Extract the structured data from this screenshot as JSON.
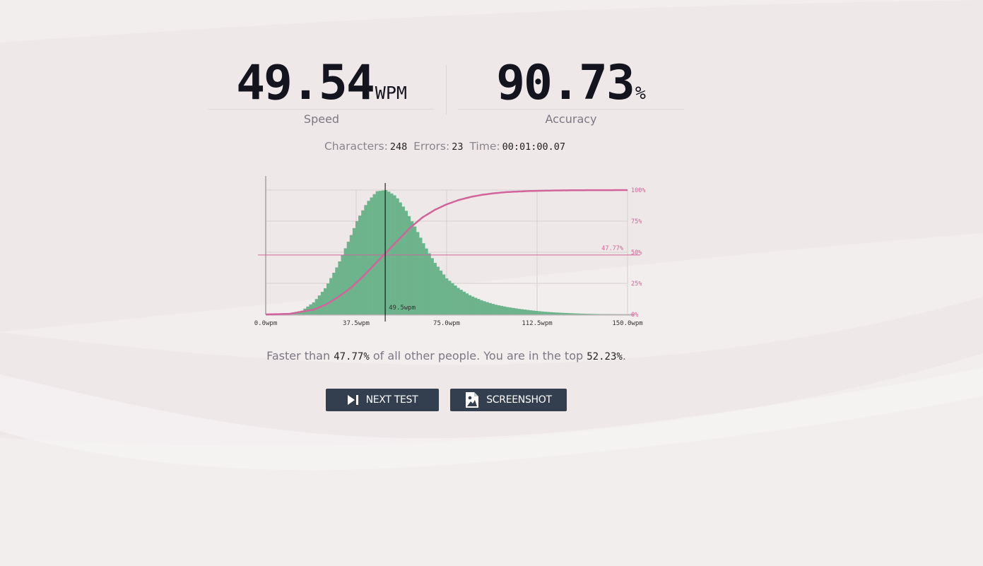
{
  "speed": {
    "value": "49.54",
    "unit": "WPM",
    "label": "Speed"
  },
  "accuracy": {
    "value": "90.73",
    "unit": "%",
    "label": "Accuracy"
  },
  "details": {
    "characters_label": "Characters:",
    "characters_value": "248",
    "errors_label": "Errors:",
    "errors_value": "23",
    "time_label": "Time:",
    "time_value": "00:01:00.07"
  },
  "summary": {
    "prefix": "Faster than",
    "faster_than": "47.77%",
    "middle": "of all other people. You are in the top",
    "top": "52.23%",
    "suffix": "."
  },
  "buttons": {
    "next_test": "NEXT TEST",
    "screenshot": "SCREENSHOT",
    "next_icon": "skip-next-icon",
    "screenshot_icon": "image-file-icon"
  },
  "colors": {
    "histogram": "#6db38c",
    "cumulative": "#d1649a",
    "button_bg": "#333f4e",
    "speed_marker": "#000000"
  },
  "chart_data": {
    "type": "area",
    "x_ticks": [
      "0.0wpm",
      "37.5wpm",
      "75.0wpm",
      "112.5wpm",
      "150.0wpm"
    ],
    "y_ticks_right": [
      "0%",
      "25%",
      "50%",
      "75%",
      "100%"
    ],
    "xlim": [
      0,
      150
    ],
    "ylim": [
      0,
      100
    ],
    "user_speed": 49.54,
    "user_speed_label": "49.5wpm",
    "percentile": 47.77,
    "percentile_label": "47.77%",
    "grid": true,
    "series": [
      {
        "kind": "histogram",
        "x": [
          0,
          10,
          15,
          20,
          25,
          30,
          35,
          38,
          42,
          46,
          50,
          54,
          58,
          62,
          66,
          70,
          75,
          80,
          85,
          90,
          95,
          100,
          105,
          110,
          115,
          120,
          125,
          130,
          135,
          140,
          145,
          150
        ],
        "values": [
          0,
          1,
          3,
          10,
          22,
          40,
          62,
          76,
          90,
          99,
          100,
          95,
          84,
          70,
          55,
          42,
          29,
          21,
          15,
          11,
          8,
          6,
          4.5,
          3.3,
          2.3,
          1.6,
          1.1,
          0.7,
          0.4,
          0.2,
          0.1,
          0
        ]
      },
      {
        "kind": "cumulative",
        "x": [
          0,
          10,
          20,
          25,
          30,
          35,
          40,
          45,
          50,
          55,
          60,
          65,
          70,
          75,
          80,
          85,
          90,
          95,
          100,
          110,
          120,
          130,
          150
        ],
        "values": [
          0,
          0.5,
          4,
          8,
          14,
          21,
          30,
          40,
          50,
          60,
          70,
          78,
          84,
          88.5,
          92,
          94.5,
          96.3,
          97.5,
          98.4,
          99.3,
          99.7,
          99.9,
          100
        ]
      }
    ]
  }
}
